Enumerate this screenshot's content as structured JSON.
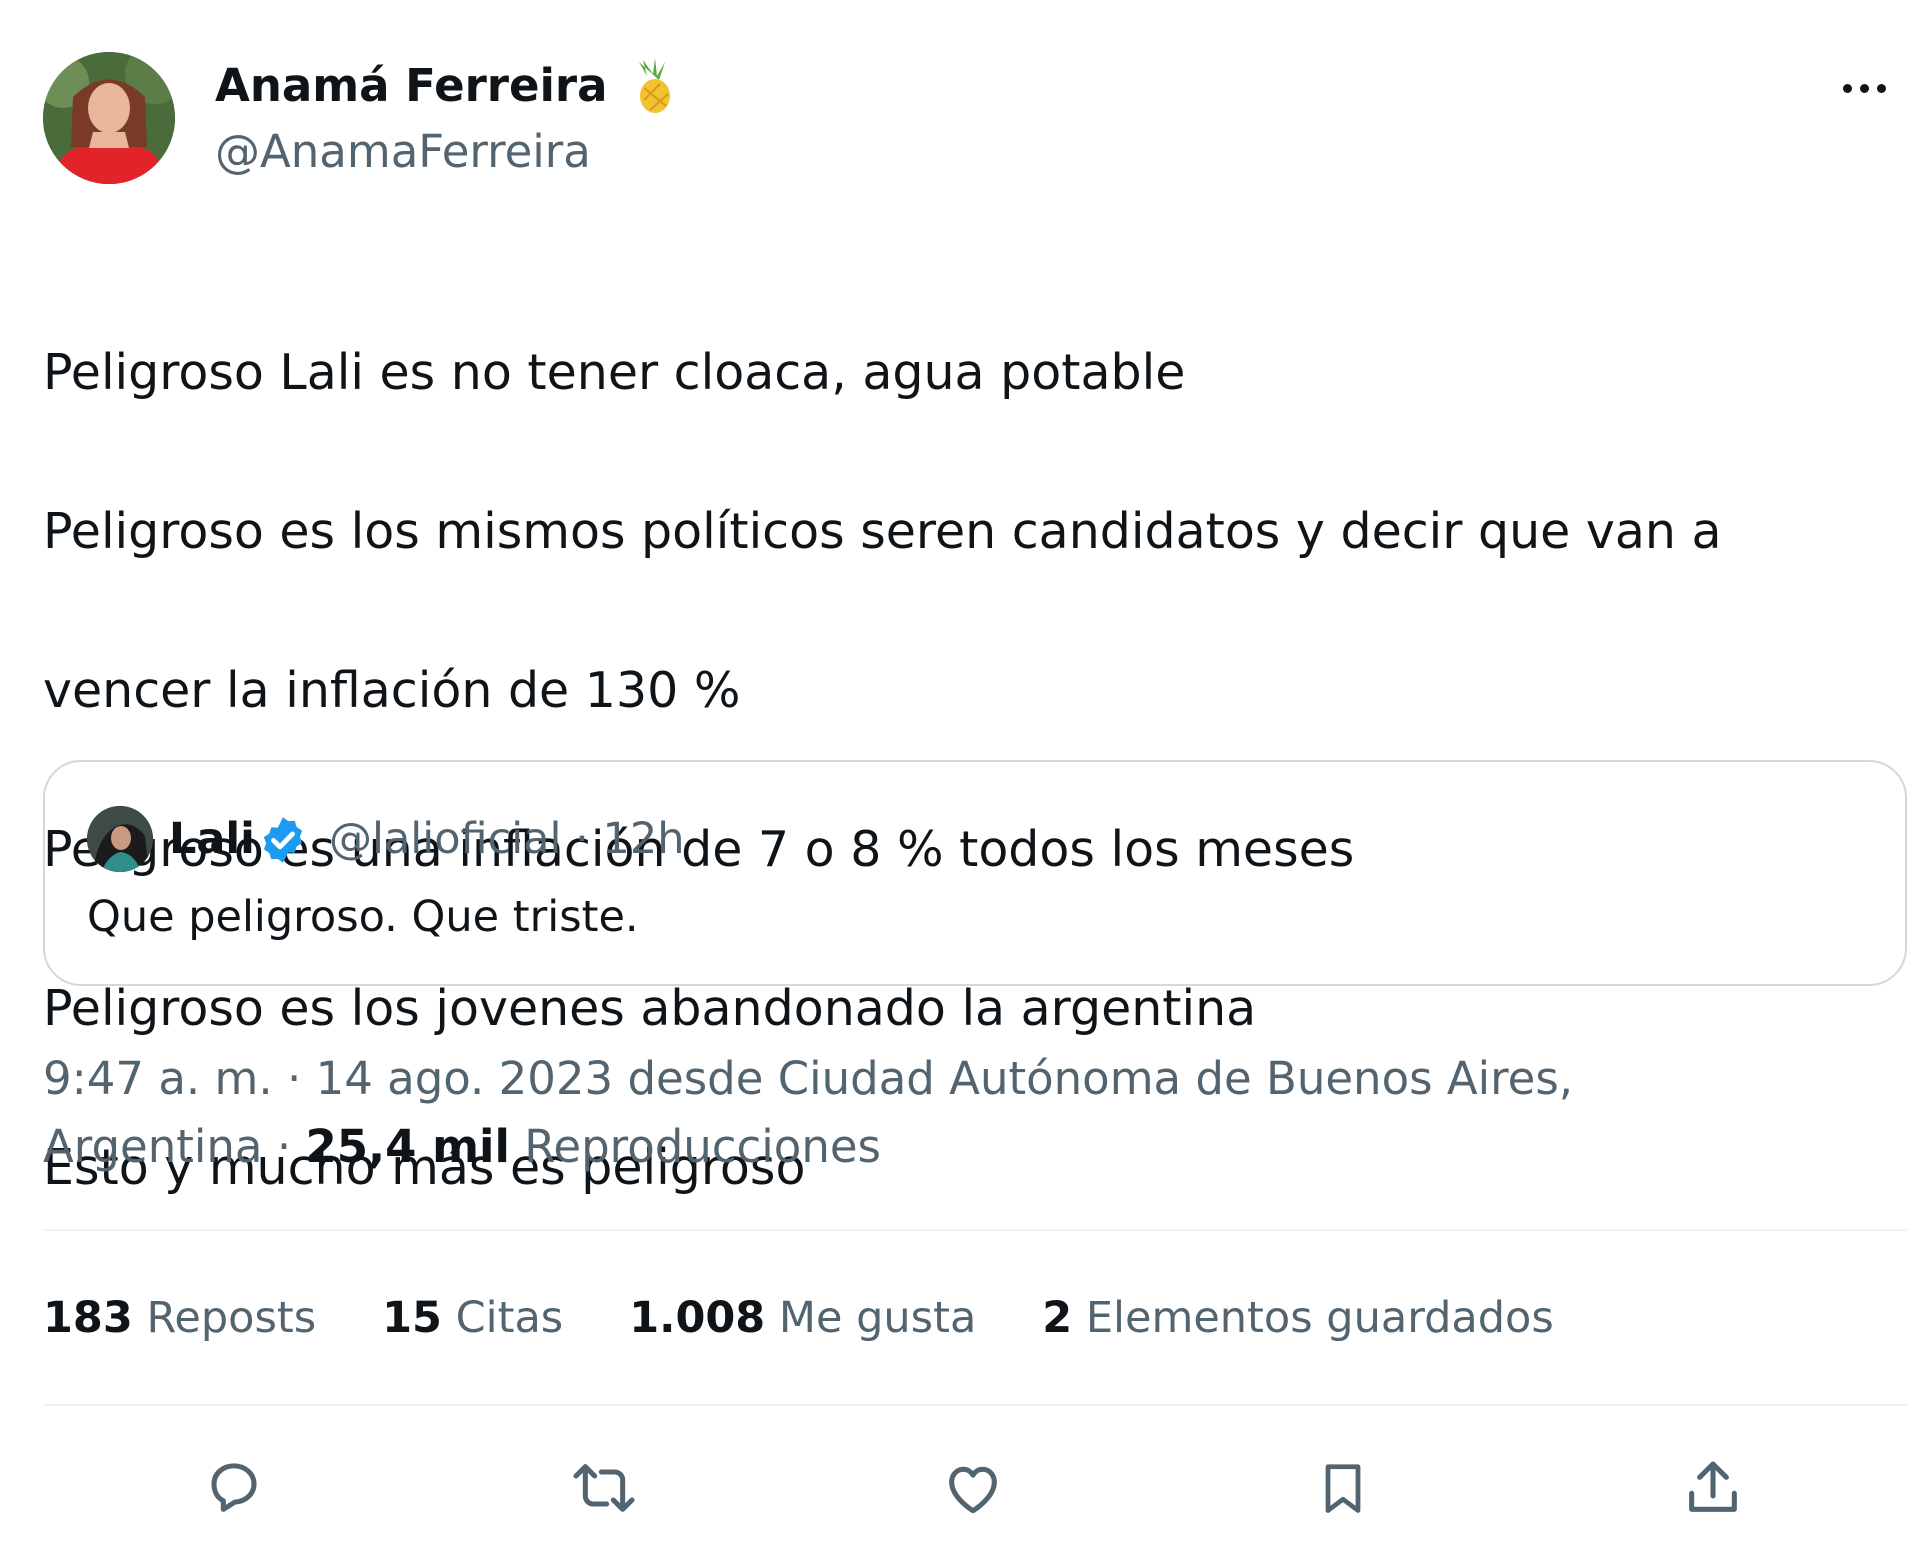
{
  "author": {
    "display_name": "Anamá Ferreira",
    "emoji": "pineapple-icon",
    "handle": "@AnamaFerreira"
  },
  "tweet": {
    "lines": [
      "Peligroso Lali es no tener cloaca, agua potable",
      "Peligroso es los mismos políticos seren  candidatos y decir que van a",
      "vencer la inflación de 130 %",
      "Peligroso es una inflación de 7 o 8 % todos los meses",
      "Peligroso es los jovenes abandonado la argentina",
      "Esto y mucho más es peligroso"
    ]
  },
  "quote": {
    "name": "Lali",
    "verified": true,
    "handle_time": "@lalioficial · 12h",
    "text": "Que peligroso. Que triste."
  },
  "meta": {
    "timestamp_line1": "9:47 a. m. · 14 ago. 2023 desde Ciudad Autónoma de Buenos Aires,",
    "location_end": "Argentina",
    "views_sep": " · ",
    "views_count": "25,4 mil",
    "views_label": "Reproducciones"
  },
  "stats": [
    {
      "count": "183",
      "label": "Reposts"
    },
    {
      "count": "15",
      "label": "Citas"
    },
    {
      "count": "1.008",
      "label": "Me gusta"
    },
    {
      "count": "2",
      "label": "Elementos guardados"
    }
  ],
  "actions": [
    "reply-icon",
    "repost-icon",
    "like-icon",
    "bookmark-icon",
    "share-icon"
  ],
  "colors": {
    "text": "#0f1419",
    "secondary": "#536471",
    "verified": "#1d9bf0",
    "border": "#cfd9de",
    "divider": "#eff3f4"
  }
}
